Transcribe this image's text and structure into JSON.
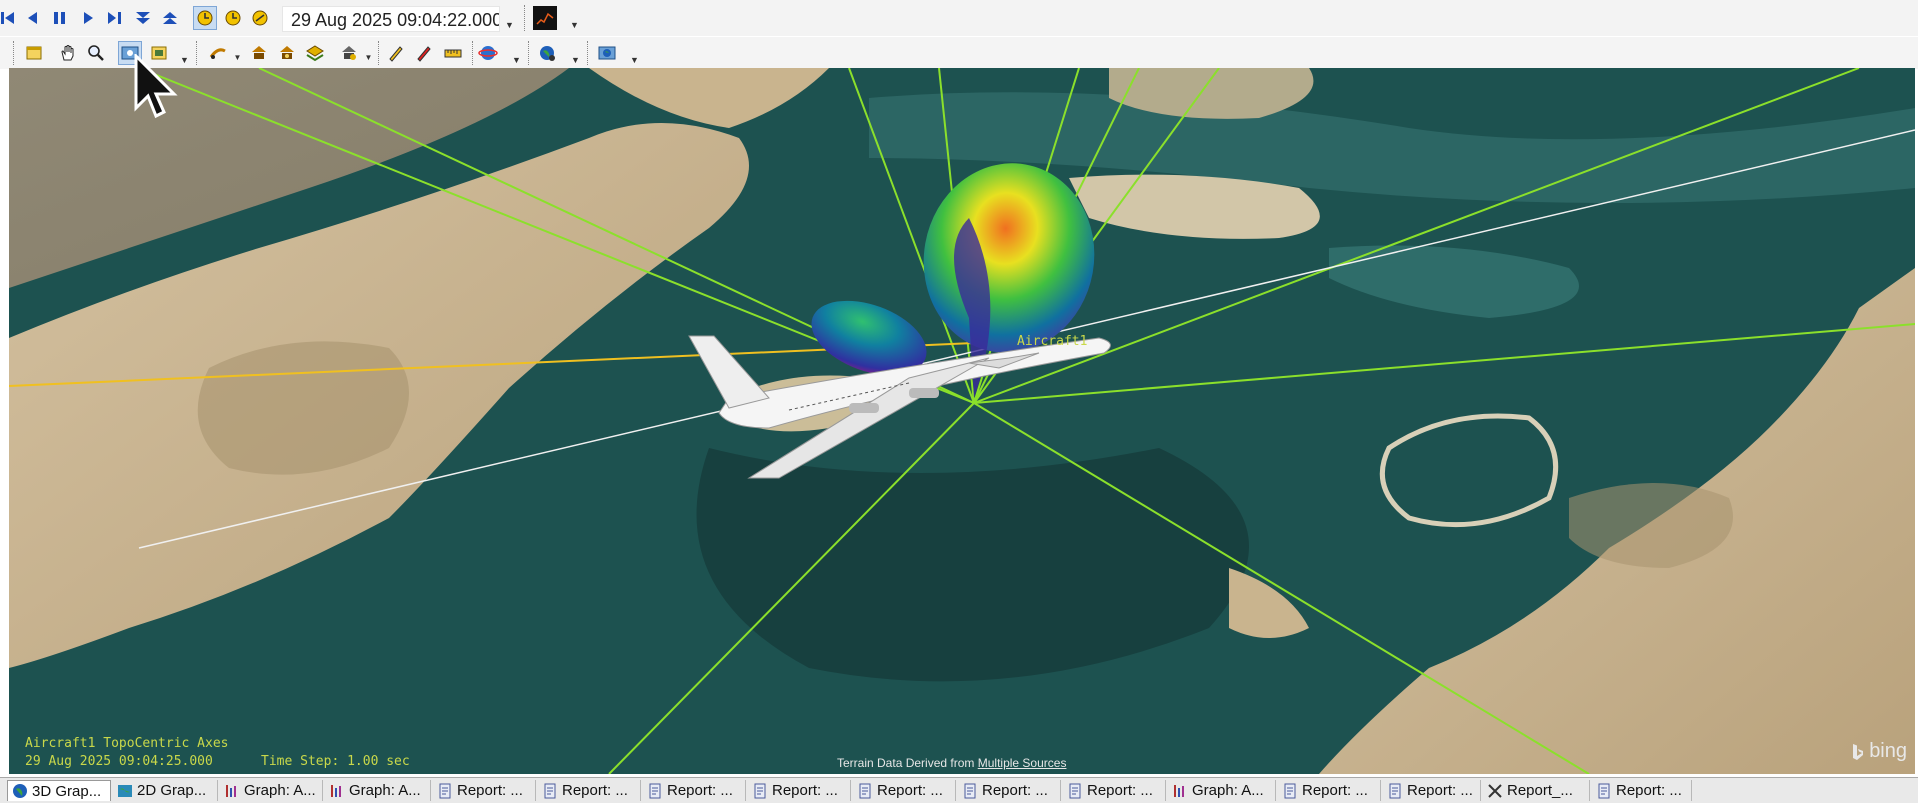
{
  "animation_toolbar": {
    "buttons": [
      {
        "name": "reset-icon",
        "label": "Reset"
      },
      {
        "name": "step-back-icon",
        "label": "Step back"
      },
      {
        "name": "pause-icon",
        "label": "Pause"
      },
      {
        "name": "play-icon",
        "label": "Play forward"
      },
      {
        "name": "step-forward-icon",
        "label": "Step forward"
      },
      {
        "name": "decrease-time-step-icon",
        "label": "Decrease time step"
      },
      {
        "name": "increase-time-step-icon",
        "label": "Increase time step"
      },
      {
        "name": "realtime-icon",
        "label": "Real time"
      },
      {
        "name": "x-realtime-icon",
        "label": "X real time"
      },
      {
        "name": "animation-mode-icon",
        "label": "Animation mode"
      }
    ],
    "current_time": "29 Aug 2025 09:04:22.000",
    "extra_button": "chart-window-icon"
  },
  "viewer_toolbar": {
    "buttons": [
      "properties-icon",
      "pan-hand-icon",
      "zoom-icon",
      "view-from-to-icon",
      "snapshot-icon",
      "measure-icon",
      "globe-object-icon",
      "sensor-icon",
      "layer-icon",
      "access-icon",
      "pencil-icon",
      "marker-pen-icon",
      "ruler-icon",
      "orbit-icon",
      "globe-icon",
      "save-image-icon"
    ],
    "active_button": "view-from-to-icon"
  },
  "viewport": {
    "overlay_axes_label": "Aircraft1 TopoCentric Axes",
    "overlay_time": "29 Aug 2025 09:04:25.000",
    "overlay_time_step": "Time Step: 1.00 sec",
    "object_label": "Aircraft1",
    "terrain_credit_prefix": "Terrain Data Derived from",
    "terrain_credit_link": "Multiple Sources",
    "map_logo": "bing",
    "colors": {
      "water": "#1d5250",
      "desert": "#c9b48e",
      "link_line": "#8be02b",
      "ground_track": "#f0c020"
    }
  },
  "tabs": [
    {
      "label": "3D Grap...",
      "icon": "globe-3d-icon",
      "active": true
    },
    {
      "label": "2D Grap...",
      "icon": "map-2d-icon",
      "active": false
    },
    {
      "label": "Graph: A...",
      "icon": "graph-icon",
      "active": false
    },
    {
      "label": "Graph: A...",
      "icon": "graph-icon",
      "active": false
    },
    {
      "label": "Report: ...",
      "icon": "report-icon",
      "active": false
    },
    {
      "label": "Report: ...",
      "icon": "report-icon",
      "active": false
    },
    {
      "label": "Report: ...",
      "icon": "report-icon",
      "active": false
    },
    {
      "label": "Report: ...",
      "icon": "report-icon",
      "active": false
    },
    {
      "label": "Report: ...",
      "icon": "report-icon",
      "active": false
    },
    {
      "label": "Report: ...",
      "icon": "report-icon",
      "active": false
    },
    {
      "label": "Report: ...",
      "icon": "report-icon",
      "active": false
    },
    {
      "label": "Graph: A...",
      "icon": "graph-icon",
      "active": false
    },
    {
      "label": "Report: ...",
      "icon": "report-icon",
      "active": false
    },
    {
      "label": "Report: ...",
      "icon": "report-icon",
      "active": false
    },
    {
      "label": "Report_...",
      "icon": "tools-icon",
      "active": false
    },
    {
      "label": "Report: ...",
      "icon": "report-icon",
      "active": false
    }
  ]
}
